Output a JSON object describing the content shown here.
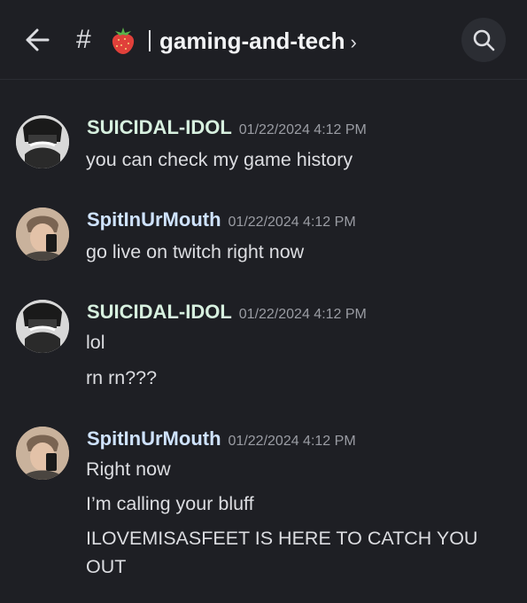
{
  "header": {
    "hash": "#",
    "channel_name": "gaming-and-tech",
    "chevron": "›",
    "back_icon": "back-arrow-icon",
    "emoji_icon": "strawberry-icon",
    "search_icon": "search-icon"
  },
  "messages": [
    {
      "author": "SUICIDAL-IDOL",
      "timestamp": "01/22/2024 4:12 PM",
      "lines": [
        "you can check my game history"
      ]
    },
    {
      "author": "SpitInUrMouth",
      "timestamp": "01/22/2024 4:12 PM",
      "lines": [
        "go live on twitch right now"
      ]
    },
    {
      "author": "SUICIDAL-IDOL",
      "timestamp": "01/22/2024 4:12 PM",
      "lines": [
        "lol",
        "rn rn???"
      ]
    },
    {
      "author": "SpitInUrMouth",
      "timestamp": "01/22/2024 4:12 PM",
      "lines": [
        "Right now",
        "I’m calling your bluff",
        "ILOVEMISASFEET IS HERE TO CATCH YOU",
        "OUT"
      ]
    }
  ],
  "colors": {
    "background": "#1e1f24",
    "user_a": "#d7f0df",
    "user_b": "#cfe3ff",
    "timestamp": "#9a9ca3"
  }
}
